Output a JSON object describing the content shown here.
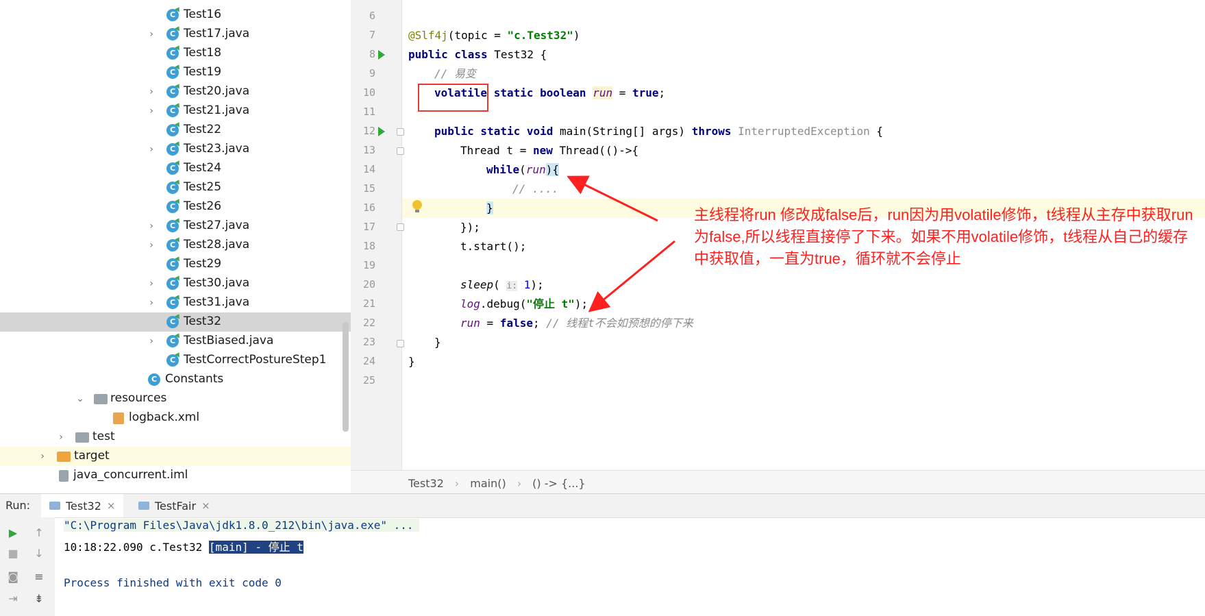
{
  "project_tree": {
    "items": [
      {
        "label": "Test16",
        "chevron": false
      },
      {
        "label": "Test17.java",
        "chevron": true
      },
      {
        "label": "Test18",
        "chevron": false
      },
      {
        "label": "Test19",
        "chevron": false
      },
      {
        "label": "Test20.java",
        "chevron": true
      },
      {
        "label": "Test21.java",
        "chevron": true
      },
      {
        "label": "Test22",
        "chevron": false
      },
      {
        "label": "Test23.java",
        "chevron": true
      },
      {
        "label": "Test24",
        "chevron": false
      },
      {
        "label": "Test25",
        "chevron": false
      },
      {
        "label": "Test26",
        "chevron": false
      },
      {
        "label": "Test27.java",
        "chevron": true
      },
      {
        "label": "Test28.java",
        "chevron": true
      },
      {
        "label": "Test29",
        "chevron": false
      },
      {
        "label": "Test30.java",
        "chevron": true
      },
      {
        "label": "Test31.java",
        "chevron": true
      },
      {
        "label": "Test32",
        "chevron": false,
        "selected": true
      },
      {
        "label": "TestBiased.java",
        "chevron": true
      },
      {
        "label": "TestCorrectPostureStep1",
        "chevron": false
      }
    ],
    "constants": "Constants",
    "resources": "resources",
    "logback": "logback.xml",
    "test": "test",
    "target": "target",
    "iml": "java_concurrent.iml"
  },
  "editor": {
    "line_numbers": [
      "6",
      "7",
      "8",
      "9",
      "10",
      "11",
      "12",
      "13",
      "14",
      "15",
      "16",
      "17",
      "18",
      "19",
      "20",
      "21",
      "22",
      "23",
      "24",
      "25"
    ],
    "l7_ann": "@Slf4j",
    "l7_a": "(topic = ",
    "l7_str": "\"c.Test32\"",
    "l7_b": ")",
    "l8_kw": "public class",
    "l8_rest": " Test32 {",
    "l9_cmt": "// 易变",
    "l10_kw": "volatile static boolean",
    "l10_fld": "run",
    "l10_eq": " = ",
    "l10_true": "true",
    "l10_end": ";",
    "l12_kw": "public static void",
    "l12_a": " main(String[] args) ",
    "l12_throws": "throws",
    "l12_exc": " InterruptedException",
    "l12_end": " {",
    "l13_a": "Thread t = ",
    "l13_new": "new",
    "l13_b": " Thread(()->{",
    "l14_kw": "while",
    "l14_a": "(",
    "l14_fld": "run",
    "l14_b": "){",
    "l15_cmt": "// ....",
    "l16": "}",
    "l17": "});",
    "l18": "t.start();",
    "l20_fld": "sleep",
    "l20_a": "( ",
    "l20_hint": "i:",
    "l20_num": " 1",
    "l20_b": ");",
    "l21_fld": "log",
    "l21_a": ".debug(",
    "l21_str": "\"停止 t\"",
    "l21_b": ");",
    "l22_fld": "run",
    "l22_a": " = ",
    "l22_kw": "false",
    "l22_b": "; ",
    "l22_cmt": "// 线程t不会如预想的停下来",
    "l23": "}",
    "l24": "}"
  },
  "annotation": "主线程将run 修改成false后，run因为用volatile修饰，t线程从主存中获取run为false,所以线程直接停了下来。如果不用volatile修饰，t线程从自己的缓存中获取值，一直为true，循环就不会停止",
  "breadcrumb": [
    "Test32",
    "main()",
    "() -> {...}"
  ],
  "run_panel": {
    "label": "Run:",
    "tabs": [
      "Test32",
      "TestFair"
    ],
    "console_cmd": "\"C:\\Program Files\\Java\\jdk1.8.0_212\\bin\\java.exe\" ...",
    "console_log_prefix": "10:18:22.090 c.Test32 ",
    "console_log_sel": "[main] - 停止 t",
    "console_exit": "Process finished with exit code 0"
  },
  "colors": {
    "annotation": "#ff2020",
    "keyword": "#000080",
    "string": "#008000",
    "field": "#660e7a",
    "selection": "#214283"
  },
  "icons": [
    "class-icon",
    "chevron-right-icon",
    "chevron-down-icon",
    "folder-icon",
    "xml-file-icon",
    "run-gutter-icon",
    "bulb-icon",
    "play-icon",
    "stop-icon",
    "camera-icon",
    "up-arrow-icon",
    "down-arrow-icon",
    "wrap-icon",
    "sort-icon",
    "exit-icon"
  ]
}
